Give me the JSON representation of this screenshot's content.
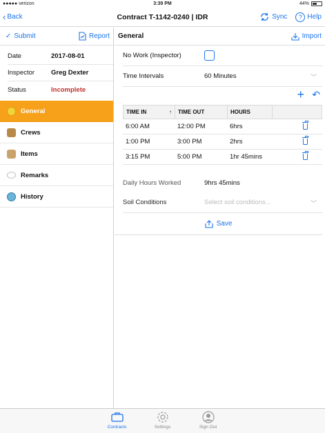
{
  "status_bar": {
    "carrier": "●●●●● verizon",
    "time": "3:39 PM",
    "battery": "44%"
  },
  "nav": {
    "back_label": "Back",
    "title": "Contract T-1142-0240 | IDR",
    "sync_label": "Sync",
    "help_label": "Help"
  },
  "sidebar": {
    "submit_label": "Submit",
    "report_label": "Report",
    "info": [
      {
        "label": "Date",
        "value": "2017-08-01"
      },
      {
        "label": "Inspector",
        "value": "Greg Dexter"
      },
      {
        "label": "Status",
        "value": "Incomplete"
      }
    ],
    "items": [
      {
        "label": "General",
        "icon": "general-icon",
        "active": true
      },
      {
        "label": "Crews",
        "icon": "crews-icon"
      },
      {
        "label": "Items",
        "icon": "items-icon"
      },
      {
        "label": "Remarks",
        "icon": "remarks-icon"
      },
      {
        "label": "History",
        "icon": "history-icon"
      }
    ]
  },
  "main": {
    "title": "General",
    "import_label": "Import",
    "no_work_label": "No Work (Inspector)",
    "time_intervals_label": "Time Intervals",
    "time_intervals_value": "60 Minutes",
    "table": {
      "headers": [
        "TIME IN",
        "TIME OUT",
        "HOURS"
      ],
      "sort_indicator": "↑",
      "rows": [
        {
          "time_in": "6:00 AM",
          "time_out": "12:00 PM",
          "hours": "6hrs"
        },
        {
          "time_in": "1:00 PM",
          "time_out": "3:00 PM",
          "hours": "2hrs"
        },
        {
          "time_in": "3:15 PM",
          "time_out": "5:00 PM",
          "hours": "1hr 45mins"
        }
      ]
    },
    "daily_hours_label": "Daily Hours Worked",
    "daily_hours_value": "9hrs 45mins",
    "soil_label": "Soil Conditions",
    "soil_placeholder": "Select soil conditions...",
    "save_label": "Save"
  },
  "tabbar": {
    "tabs": [
      "Contracts",
      "Settings",
      "Sign Out"
    ]
  },
  "colors": {
    "accent": "#1a73e8",
    "active_bg": "#f7a11b",
    "status_incomplete": "#c0302b"
  }
}
